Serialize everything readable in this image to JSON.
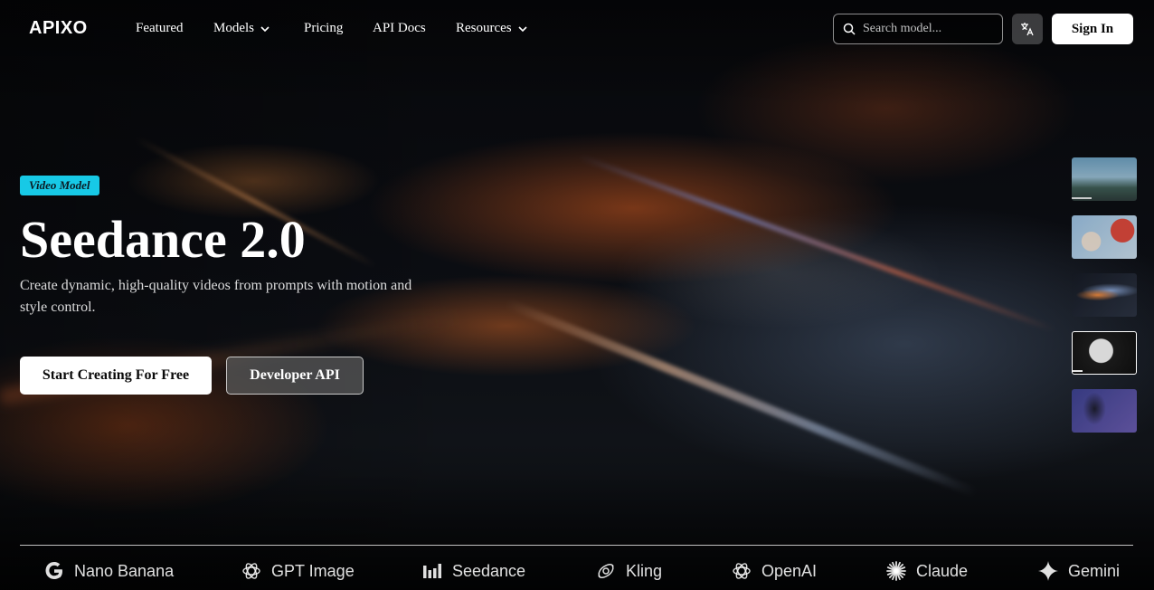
{
  "nav": {
    "logo": "APIXO",
    "items": [
      {
        "label": "Featured"
      },
      {
        "label": "Models"
      },
      {
        "label": "Pricing"
      },
      {
        "label": "API Docs"
      },
      {
        "label": "Resources"
      }
    ],
    "search_placeholder": "Search model...",
    "language_icon": "translate-icon",
    "sign_in": "Sign In"
  },
  "hero": {
    "badge": "Video Model",
    "title": "Seedance 2.0",
    "subtitle": "Create dynamic, high-quality videos from prompts with motion and style control.",
    "primary_cta": "Start Creating For Free",
    "secondary_cta": "Developer API",
    "thumbnails": [
      {
        "icon": "runner-scene-thumb",
        "active": false,
        "progress": 0.3
      },
      {
        "icon": "flowers-scene-thumb",
        "active": false
      },
      {
        "icon": "light-streak-thumb",
        "active": false
      },
      {
        "icon": "helmet-scene-thumb",
        "active": true,
        "progress": 0.15
      },
      {
        "icon": "dancer-scene-thumb",
        "active": false
      }
    ]
  },
  "brands": [
    {
      "label": "Nano Banana",
      "icon": "google-icon"
    },
    {
      "label": "GPT Image",
      "icon": "openai-icon"
    },
    {
      "label": "Seedance",
      "icon": "bars-icon"
    },
    {
      "label": "Kling",
      "icon": "kling-icon"
    },
    {
      "label": "OpenAI",
      "icon": "openai-icon"
    },
    {
      "label": "Claude",
      "icon": "claude-icon"
    },
    {
      "label": "Gemini",
      "icon": "gemini-icon"
    }
  ],
  "colors": {
    "badge": "#17c9e6",
    "background": "#050608"
  }
}
